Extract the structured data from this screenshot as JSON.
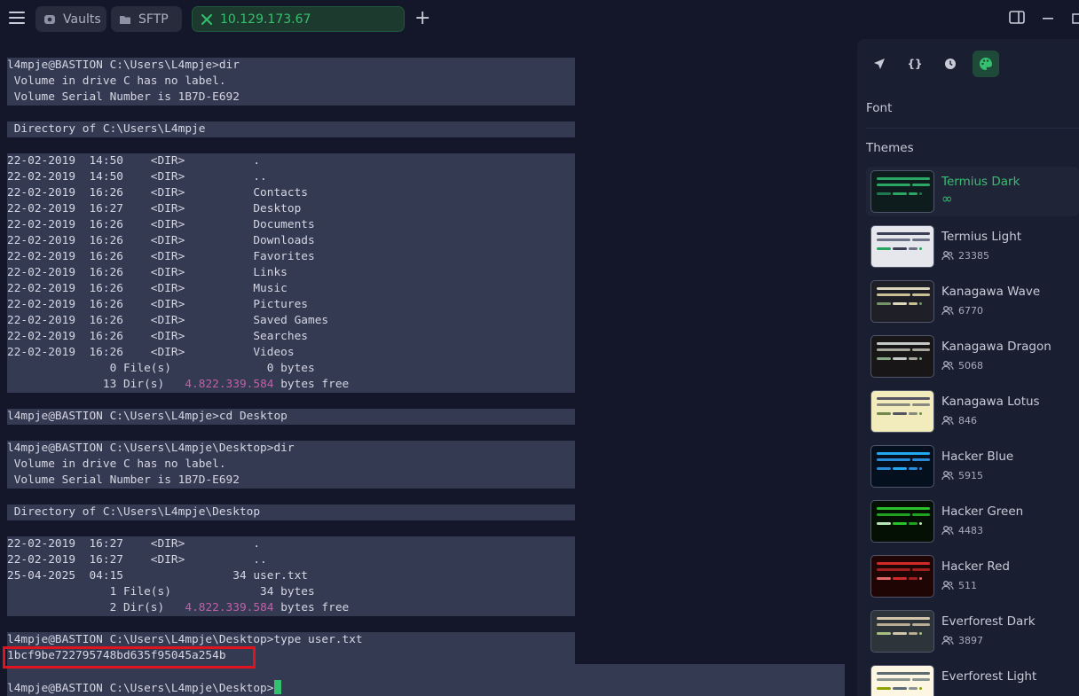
{
  "tabs": [
    {
      "label": "Vaults",
      "icon": "vault-icon"
    },
    {
      "label": "SFTP",
      "icon": "folder-icon"
    },
    {
      "label": "10.129.173.67",
      "icon": "close-icon"
    }
  ],
  "terminal": {
    "lines": [
      {
        "t": "l4mpje@BASTION C:\\Users\\L4mpje>dir",
        "hl": 1
      },
      {
        "t": " Volume in drive C has no label.",
        "hl": 1
      },
      {
        "t": " Volume Serial Number is 1B7D-E692",
        "hl": 1
      },
      {
        "t": "",
        "hl": 0
      },
      {
        "t": " Directory of C:\\Users\\L4mpje",
        "hl": 1
      },
      {
        "t": "",
        "hl": 0
      },
      {
        "t": "22-02-2019  14:50    <DIR>          .",
        "hl": 1
      },
      {
        "t": "22-02-2019  14:50    <DIR>          ..",
        "hl": 1
      },
      {
        "t": "22-02-2019  16:26    <DIR>          Contacts",
        "hl": 1
      },
      {
        "t": "22-02-2019  16:27    <DIR>          Desktop",
        "hl": 1
      },
      {
        "t": "22-02-2019  16:26    <DIR>          Documents",
        "hl": 1
      },
      {
        "t": "22-02-2019  16:26    <DIR>          Downloads",
        "hl": 1
      },
      {
        "t": "22-02-2019  16:26    <DIR>          Favorites",
        "hl": 1
      },
      {
        "t": "22-02-2019  16:26    <DIR>          Links",
        "hl": 1
      },
      {
        "t": "22-02-2019  16:26    <DIR>          Music",
        "hl": 1
      },
      {
        "t": "22-02-2019  16:26    <DIR>          Pictures",
        "hl": 1
      },
      {
        "t": "22-02-2019  16:26    <DIR>          Saved Games",
        "hl": 1
      },
      {
        "t": "22-02-2019  16:26    <DIR>          Searches",
        "hl": 1
      },
      {
        "t": "22-02-2019  16:26    <DIR>          Videos",
        "hl": 1
      },
      {
        "t": "               0 File(s)              0 bytes",
        "hl": 1
      },
      {
        "t": "              13 Dir(s)   ",
        "m": "4.822.339.584",
        "post": " bytes free",
        "hl": 1
      },
      {
        "t": "",
        "hl": 0
      },
      {
        "t": "l4mpje@BASTION C:\\Users\\L4mpje>cd Desktop",
        "hl": 1
      },
      {
        "t": "",
        "hl": 0
      },
      {
        "t": "l4mpje@BASTION C:\\Users\\L4mpje\\Desktop>dir",
        "hl": 1
      },
      {
        "t": " Volume in drive C has no label.",
        "hl": 1
      },
      {
        "t": " Volume Serial Number is 1B7D-E692",
        "hl": 1
      },
      {
        "t": "",
        "hl": 0
      },
      {
        "t": " Directory of C:\\Users\\L4mpje\\Desktop",
        "hl": 1
      },
      {
        "t": "",
        "hl": 0
      },
      {
        "t": "22-02-2019  16:27    <DIR>          .",
        "hl": 1
      },
      {
        "t": "22-02-2019  16:27    <DIR>          ..",
        "hl": 1
      },
      {
        "t": "25-04-2025  04:15                34 user.txt",
        "hl": 1
      },
      {
        "t": "               1 File(s)             34 bytes",
        "hl": 1
      },
      {
        "t": "               2 Dir(s)   ",
        "m": "4.822.339.584",
        "post": " bytes free",
        "hl": 1
      },
      {
        "t": "",
        "hl": 0
      },
      {
        "t": "l4mpje@BASTION C:\\Users\\L4mpje\\Desktop>type user.txt",
        "hl": 1
      },
      {
        "t": "1bcf9be722795748bd635f95045a254b",
        "hl": 1
      },
      {
        "t": "",
        "hl": 2
      },
      {
        "t": "l4mpje@BASTION C:\\Users\\L4mpje\\Desktop>",
        "hl": 2,
        "cursor": true
      }
    ]
  },
  "panel": {
    "font_title": "Font",
    "themes_title": "Themes",
    "themes": [
      {
        "name": "Termius Dark",
        "count": "∞",
        "selected": true,
        "bg": "#0f1c1d",
        "c1": "#2aa765",
        "c2": "#2aa765",
        "c3": "#1f7a52"
      },
      {
        "name": "Termius Light",
        "count": "23385",
        "bg": "#e6e7ec",
        "c1": "#3a3f55",
        "c2": "#6c7186",
        "c3": "#25a55d"
      },
      {
        "name": "Kanagawa Wave",
        "count": "6770",
        "bg": "#1f1f28",
        "c1": "#dcd7ba",
        "c2": "#c8c093",
        "c3": "#76946a"
      },
      {
        "name": "Kanagawa Dragon",
        "count": "5068",
        "bg": "#181616",
        "c1": "#c5c9c5",
        "c2": "#a6a69c",
        "c3": "#87a987"
      },
      {
        "name": "Kanagawa Lotus",
        "count": "846",
        "bg": "#f2ecbc",
        "c1": "#545464",
        "c2": "#8a8980",
        "c3": "#6f894e"
      },
      {
        "name": "Hacker Blue",
        "count": "5915",
        "bg": "#05101e",
        "c1": "#22a9f2",
        "c2": "#2a8bd8",
        "c3": "#2a8bd8"
      },
      {
        "name": "Hacker Green",
        "count": "4483",
        "bg": "#051005",
        "c1": "#28c22a",
        "c2": "#1fa21f",
        "c3": "#b9e6b9"
      },
      {
        "name": "Hacker Red",
        "count": "511",
        "bg": "#200505",
        "c1": "#d22a2a",
        "c2": "#a21f1f",
        "c3": "#e66a6a"
      },
      {
        "name": "Everforest Dark",
        "count": "3897",
        "bg": "#2d353b",
        "c1": "#d3c6aa",
        "c2": "#b8ad92",
        "c3": "#a7c080"
      },
      {
        "name": "Everforest Light",
        "count": "",
        "bg": "#fdf6e3",
        "c1": "#5c6a72",
        "c2": "#8a948f",
        "c3": "#8da101"
      }
    ]
  }
}
